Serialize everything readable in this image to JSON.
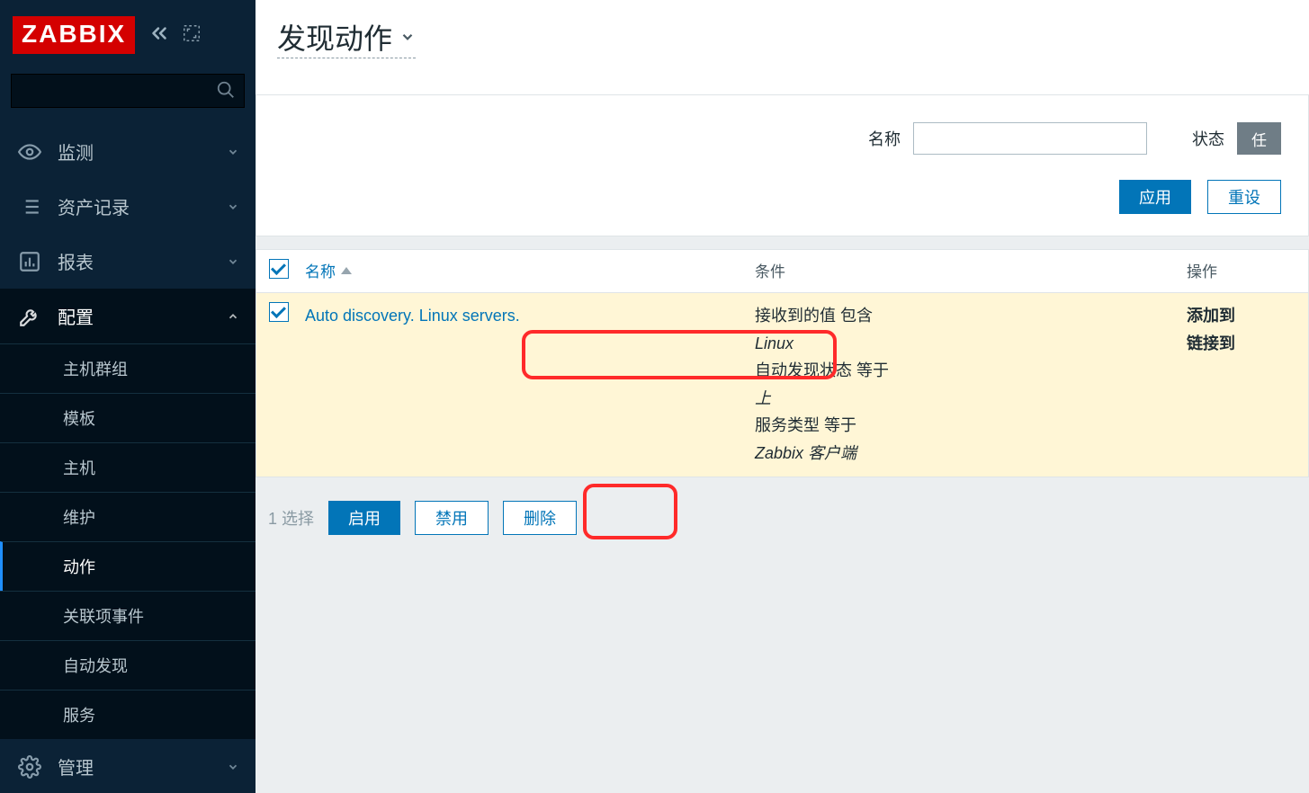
{
  "brand": "ZABBIX",
  "search": {
    "placeholder": ""
  },
  "nav": {
    "monitoring": "监测",
    "inventory": "资产记录",
    "reports": "报表",
    "config": "配置",
    "admin": "管理"
  },
  "config_sub": {
    "hostgroups": "主机群组",
    "templates": "模板",
    "hosts": "主机",
    "maintenance": "维护",
    "actions": "动作",
    "correlation": "关联项事件",
    "discovery": "自动发现",
    "services": "服务"
  },
  "page": {
    "title": "发现动作"
  },
  "filter": {
    "name_label": "名称",
    "name_value": "",
    "status_label": "状态",
    "status_btn": "任",
    "apply": "应用",
    "reset": "重设"
  },
  "table": {
    "head": {
      "name": "名称",
      "cond": "条件",
      "ops": "操作"
    },
    "rows": [
      {
        "checked": true,
        "name": "Auto discovery. Linux servers.",
        "cond": [
          {
            "pre": "接收到的值 包含 ",
            "em": "Linux"
          },
          {
            "pre": "自动发现状态 等于 ",
            "em": "上"
          },
          {
            "pre": "服务类型 等于 ",
            "em": "Zabbix 客户端"
          }
        ],
        "ops": [
          "添加到",
          "链接到"
        ]
      }
    ]
  },
  "bulk": {
    "selected_prefix": "1",
    "selected_label": "选择",
    "enable": "启用",
    "disable": "禁用",
    "delete": "删除"
  }
}
